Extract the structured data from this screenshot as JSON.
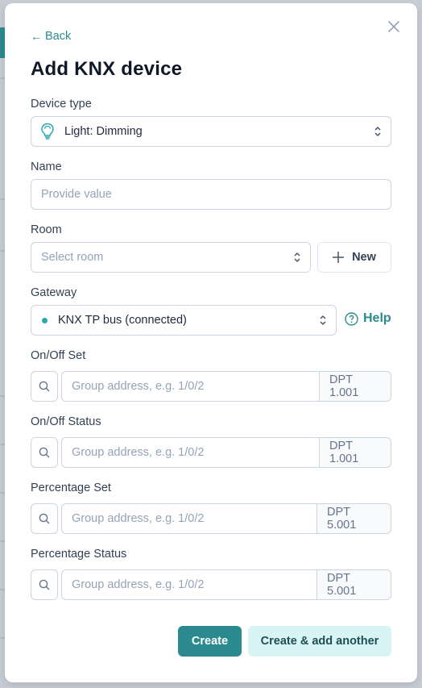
{
  "modal": {
    "back_label": "Back",
    "title": "Add KNX device",
    "close_icon": "close-icon"
  },
  "device_type": {
    "label": "Device type",
    "value": "Light: Dimming",
    "icon": "lightbulb-icon"
  },
  "name": {
    "label": "Name",
    "placeholder": "Provide value",
    "value": ""
  },
  "room": {
    "label": "Room",
    "placeholder": "Select room",
    "new_button_label": "New"
  },
  "gateway": {
    "label": "Gateway",
    "value": "KNX TP bus (connected)",
    "status_color": "#2aa7ad",
    "help_label": "Help"
  },
  "addresses": [
    {
      "label": "On/Off Set",
      "placeholder": "Group address, e.g. 1/0/2",
      "dpt": "DPT 1.001"
    },
    {
      "label": "On/Off Status",
      "placeholder": "Group address, e.g. 1/0/2",
      "dpt": "DPT 1.001"
    },
    {
      "label": "Percentage Set",
      "placeholder": "Group address, e.g. 1/0/2",
      "dpt": "DPT 5.001"
    },
    {
      "label": "Percentage Status",
      "placeholder": "Group address, e.g. 1/0/2",
      "dpt": "DPT 5.001"
    }
  ],
  "footer": {
    "create_label": "Create",
    "create_another_label": "Create & add another"
  },
  "colors": {
    "accent": "#2b8a8f",
    "accent_light": "#d9f4f5"
  }
}
